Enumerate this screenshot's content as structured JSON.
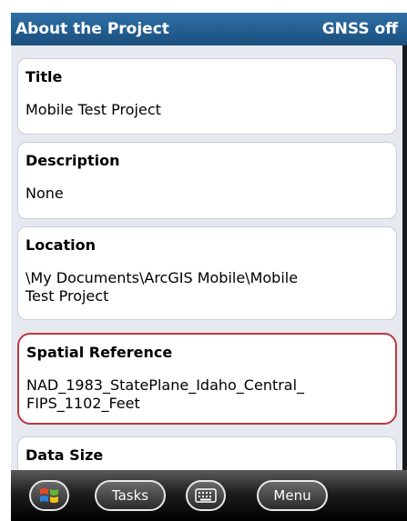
{
  "header": {
    "title": "About the Project",
    "gnss_status": "GNSS off"
  },
  "fields": {
    "title": {
      "label": "Title",
      "value": "Mobile Test Project"
    },
    "description": {
      "label": "Description",
      "value": "None"
    },
    "location": {
      "label": "Location",
      "value": "\\My Documents\\ArcGIS Mobile\\Mobile\nTest Project"
    },
    "spatial_reference": {
      "label": "Spatial Reference",
      "value": "NAD_1983_StatePlane_Idaho_Central_\nFIPS_1102_Feet"
    },
    "data_size": {
      "label": "Data Size"
    }
  },
  "taskbar": {
    "tasks_label": "Tasks",
    "menu_label": "Menu"
  },
  "icons": {
    "start": "windows-logo-icon",
    "keyboard": "keyboard-icon"
  },
  "colors": {
    "titlebar": "#1f5a8f",
    "highlight_border": "#b83a44",
    "content_bg": "#e6eaf0"
  }
}
